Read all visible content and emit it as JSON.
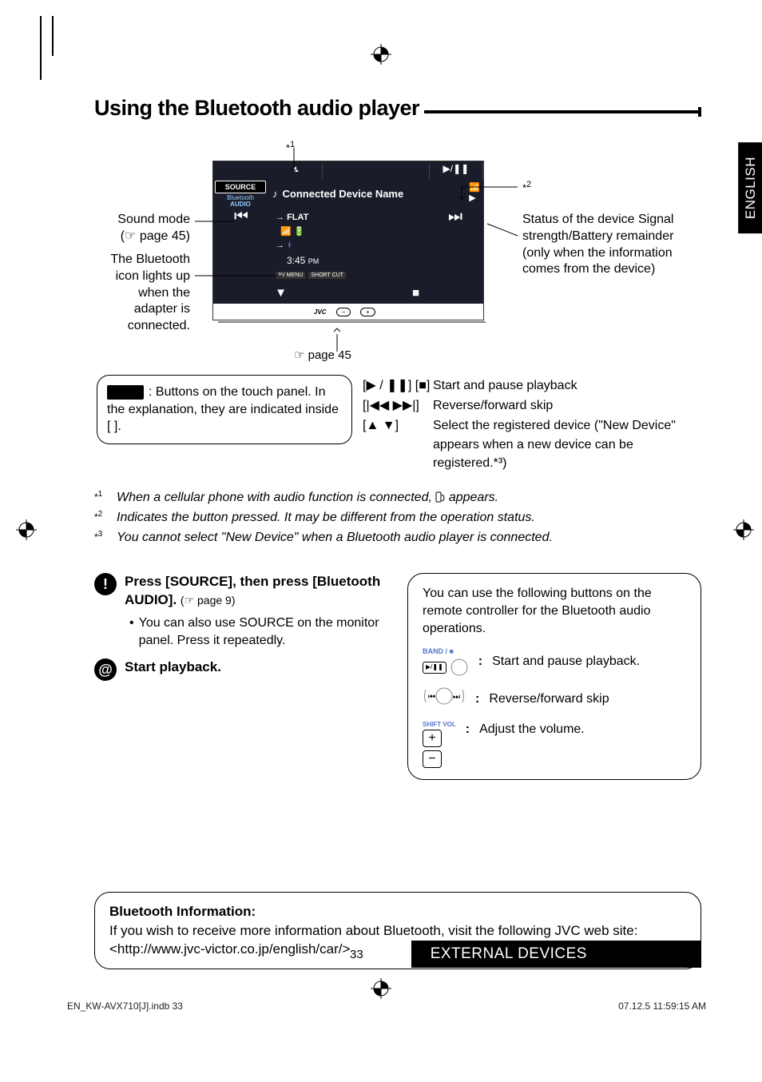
{
  "title": "Using the Bluetooth audio player",
  "lang_tab": "ENGLISH",
  "diagram": {
    "star1_marker": "*1",
    "star2_marker": "*2",
    "callout_left_1_line1": "Sound mode",
    "callout_left_1_line2": "(☞ page 45)",
    "callout_left_2": "The Bluetooth icon lights up when the adapter is connected.",
    "callout_right": "Status of the device Signal strength/Battery remainder (only when the information comes from the device)",
    "screen": {
      "source_btn": "SOURCE",
      "mode_label_line1": "Bluetooth",
      "mode_label_line2": "AUDIO",
      "device_name": "Connected Device Name",
      "flat_label": "FLAT",
      "time": "3:45",
      "ampm": "PM",
      "avmenu": "AV MENU",
      "shortcut": "SHORT CUT",
      "brand": "JVC"
    },
    "page_ref": "☞ page 45",
    "touch_note": ": Buttons on the touch panel. In the explanation, they are indicated inside [      ].",
    "controls": [
      {
        "sym": "[▶ / ❚❚] [■]",
        "desc": "Start and pause playback"
      },
      {
        "sym": "[|◀◀ ▶▶|]",
        "desc": "Reverse/forward skip"
      },
      {
        "sym": "[▲ ▼]",
        "desc": "Select the registered device (\"New Device\" appears when a new device can be registered.*³)"
      }
    ]
  },
  "footnotes": {
    "n1": "When a cellular phone with audio function is connected,",
    "n1_after": "appears.",
    "n2": "Indicates the button pressed. It may be different from the operation status.",
    "n3": "You cannot select \"New Device\" when a Bluetooth audio player is connected."
  },
  "steps": {
    "s1_bold": "Press [SOURCE], then press [Bluetooth AUDIO].",
    "s1_small": "(☞ page 9)",
    "s1_bullet": "You can also use SOURCE on the monitor panel. Press it repeatedly.",
    "s2_bold": "Start playback."
  },
  "remote": {
    "intro": "You can use the following buttons on the remote controller for the Bluetooth audio operations.",
    "band_label": "BAND / ■",
    "r1_desc": "Start and pause playback.",
    "r2_desc": "Reverse/forward skip",
    "vol_label": "SHIFT VOL",
    "r3_desc": "Adjust the volume."
  },
  "bt_info": {
    "header": "Bluetooth Information:",
    "body": "If you wish to receive more information about Bluetooth, visit the following JVC web site: <http://www.jvc-victor.co.jp/english/car/>"
  },
  "page_number": "33",
  "footer_band": "EXTERNAL DEVICES",
  "doc_footer_left": "EN_KW-AVX710[J].indb   33",
  "doc_footer_right": "07.12.5   11:59:15 AM"
}
